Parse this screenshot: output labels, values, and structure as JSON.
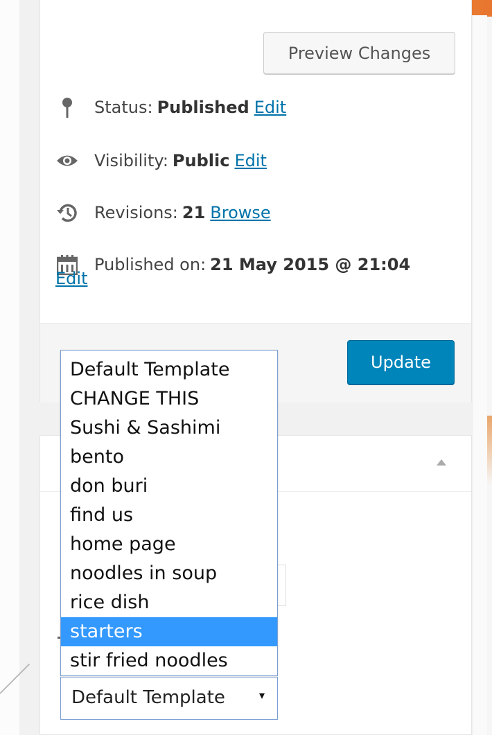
{
  "publish": {
    "preview_button": "Preview Changes",
    "status": {
      "label": "Status:",
      "value": "Published",
      "link": "Edit",
      "icon": "pin-icon"
    },
    "visibility": {
      "label": "Visibility:",
      "value": "Public",
      "link": "Edit",
      "icon": "eye-icon"
    },
    "revisions": {
      "label": "Revisions:",
      "value": "21",
      "link": "Browse",
      "icon": "history-icon"
    },
    "published_on": {
      "label": "Published on:",
      "value": "21 May 2015 @ 21:04",
      "link": "Edit",
      "icon": "calendar-icon"
    },
    "update_button": "Update"
  },
  "template_select": {
    "options": [
      "Default Template",
      "CHANGE THIS",
      "Sushi & Sashimi",
      "bento",
      "don buri",
      "find us",
      "home page",
      "noodles in soup",
      "rice dish",
      "starters",
      "stir fried noodles"
    ],
    "highlighted": "starters",
    "selected_value": "Default Template",
    "arrow": "▾"
  },
  "colors": {
    "primary": "#0085ba",
    "link": "#0073aa",
    "highlight": "#3399ff"
  }
}
